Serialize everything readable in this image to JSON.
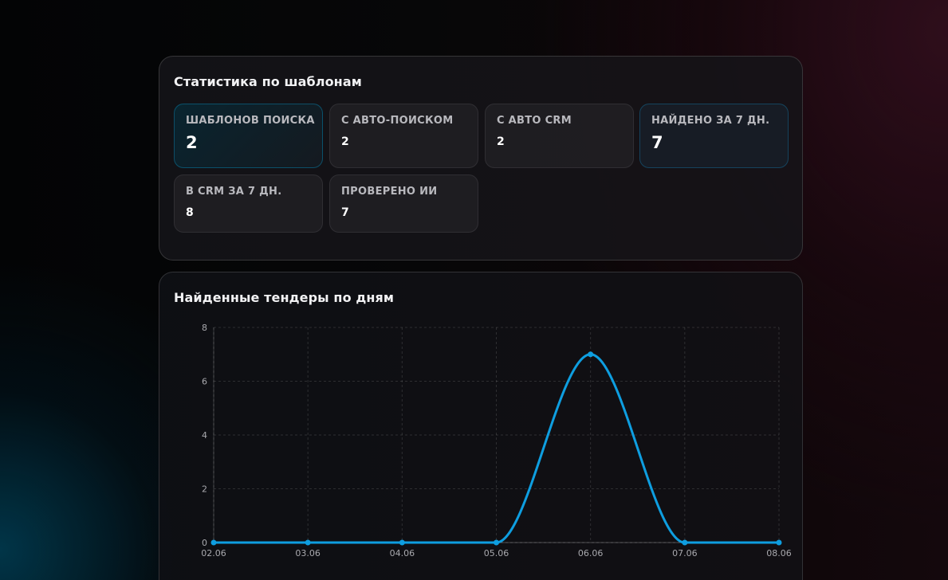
{
  "stats_panel": {
    "title": "Статистика по шаблонам",
    "cards": [
      {
        "label": "ШАБЛОНОВ ПОИСКА",
        "value": "2"
      },
      {
        "label": "С АВТО-ПОИСКОМ",
        "value": "2"
      },
      {
        "label": "С АВТО CRM",
        "value": "2"
      },
      {
        "label": "НАЙДЕНО ЗА 7 ДН.",
        "value": "7"
      },
      {
        "label": "В CRM ЗА 7 ДН.",
        "value": "8"
      },
      {
        "label": "ПРОВЕРЕНО ИИ",
        "value": "7"
      }
    ]
  },
  "chart_panel": {
    "title": "Найденные тендеры по дням"
  },
  "chart_data": {
    "type": "line",
    "title": "Найденные тендеры по дням",
    "x": [
      "02.06",
      "03.06",
      "04.06",
      "05.06",
      "06.06",
      "07.06",
      "08.06"
    ],
    "series": [
      {
        "values": [
          0,
          0,
          0,
          0,
          7,
          0,
          0
        ],
        "color": "#0e9ee0"
      }
    ],
    "ylim": [
      0,
      8
    ],
    "yticks": [
      0,
      2,
      4,
      6,
      8
    ],
    "grid": true,
    "smooth": true
  },
  "colors": {
    "accent": "#0e9ee0"
  }
}
